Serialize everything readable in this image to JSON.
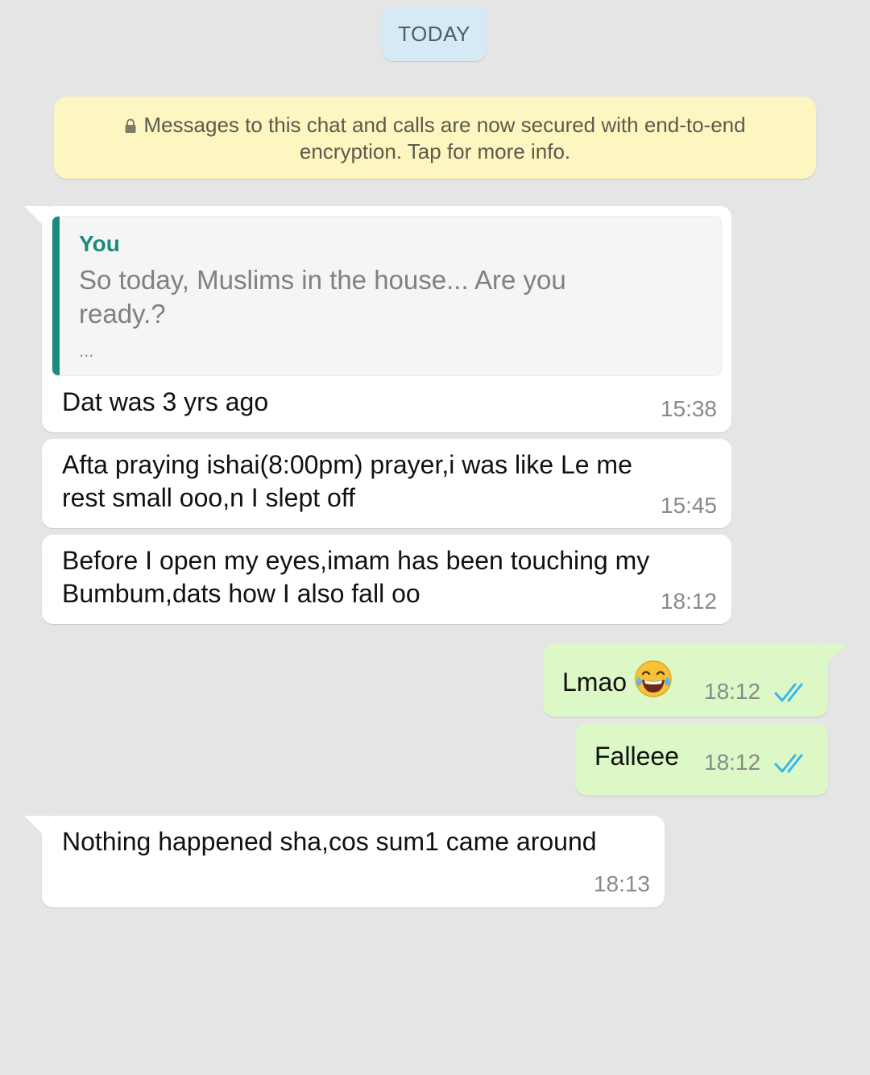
{
  "date_chip": "TODAY",
  "encryption_notice": {
    "line1": "Messages to this chat and calls are now secured with end-to-end",
    "line2": "encryption. Tap for more info."
  },
  "messages": [
    {
      "direction": "incoming",
      "quote": {
        "author": "You",
        "line1": "So today, Muslims in the house... Are you",
        "line2": "ready.?",
        "ellipsis": "..."
      },
      "text": "Dat was 3 yrs ago",
      "time": "15:38"
    },
    {
      "direction": "incoming",
      "line1": "Afta praying ishai(8:00pm) prayer,i was like Le me",
      "line2": "rest small ooo,n I slept off",
      "time": "15:45"
    },
    {
      "direction": "incoming",
      "line1": "Before I open my eyes,imam has been touching my",
      "line2": "Bumbum,dats how I also fall oo",
      "time": "18:12"
    },
    {
      "direction": "outgoing",
      "text": "Lmao",
      "emoji": "face-with-tears-of-joy",
      "time": "18:12",
      "status": "read"
    },
    {
      "direction": "outgoing",
      "text": "Falleee",
      "time": "18:12",
      "status": "read"
    },
    {
      "direction": "incoming",
      "text": "Nothing happened sha,cos sum1 came around",
      "time": "18:13"
    }
  ],
  "colors": {
    "chat_background": "#e5e5e5",
    "incoming_bubble": "#ffffff",
    "outgoing_bubble": "#dcf8c6",
    "quote_accent": "#1c8a7c",
    "read_ticks": "#34b7f1"
  }
}
